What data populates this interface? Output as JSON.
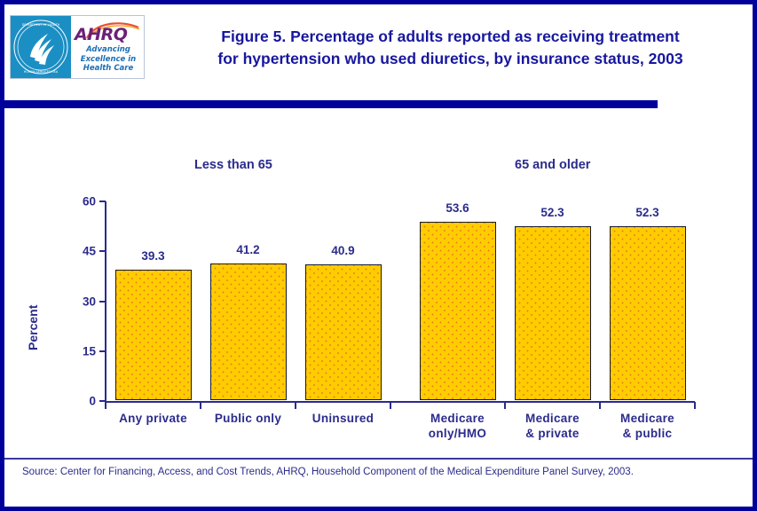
{
  "header": {
    "title_line1": "Figure 5. Percentage of adults reported as receiving treatment",
    "title_line2": "for hypertension who used diuretics, by insurance status, 2003",
    "logo": {
      "seal_name": "hhs-seal-icon",
      "ahrq_wordmark": "AHRQ",
      "ahrq_tagline": "Advancing Excellence in Health Care"
    }
  },
  "groups": {
    "young_label": "Less than 65",
    "old_label": "65 and older"
  },
  "footer": {
    "source": "Source: Center for Financing, Access, and Cost Trends, AHRQ, Household Component of the Medical Expenditure Panel Survey, 2003."
  },
  "colors": {
    "frame": "#00009B",
    "text_blue": "#2b2b8c",
    "title_blue": "#17179e",
    "bar_fill": "#FFCC00",
    "bar_dots": "#E8821E",
    "bar_border": "#1a1a2e"
  },
  "chart_data": {
    "type": "bar",
    "title": "Figure 5. Percentage of adults reported as receiving treatment for hypertension who used diuretics, by insurance status, 2003",
    "xlabel": "",
    "ylabel": "Percent",
    "ylim": [
      0,
      60
    ],
    "yticks": [
      "0",
      "15",
      "30",
      "45",
      "60"
    ],
    "ytick_values": [
      0,
      15,
      30,
      45,
      60
    ],
    "grid": false,
    "legend": "none",
    "group_headers": [
      "Less than 65",
      "65 and older"
    ],
    "categories": [
      "Any private",
      "Public only",
      "Uninsured",
      "Medicare only/HMO",
      "Medicare & private",
      "Medicare & public"
    ],
    "category_lines": [
      [
        "Any private"
      ],
      [
        "Public only"
      ],
      [
        "Uninsured"
      ],
      [
        "Medicare",
        "only/HMO"
      ],
      [
        "Medicare",
        "& private"
      ],
      [
        "Medicare",
        "& public"
      ]
    ],
    "values": [
      39.3,
      41.2,
      40.9,
      53.6,
      52.3,
      52.3
    ],
    "value_labels": [
      "39.3",
      "41.2",
      "40.9",
      "53.6",
      "52.3",
      "52.3"
    ]
  }
}
